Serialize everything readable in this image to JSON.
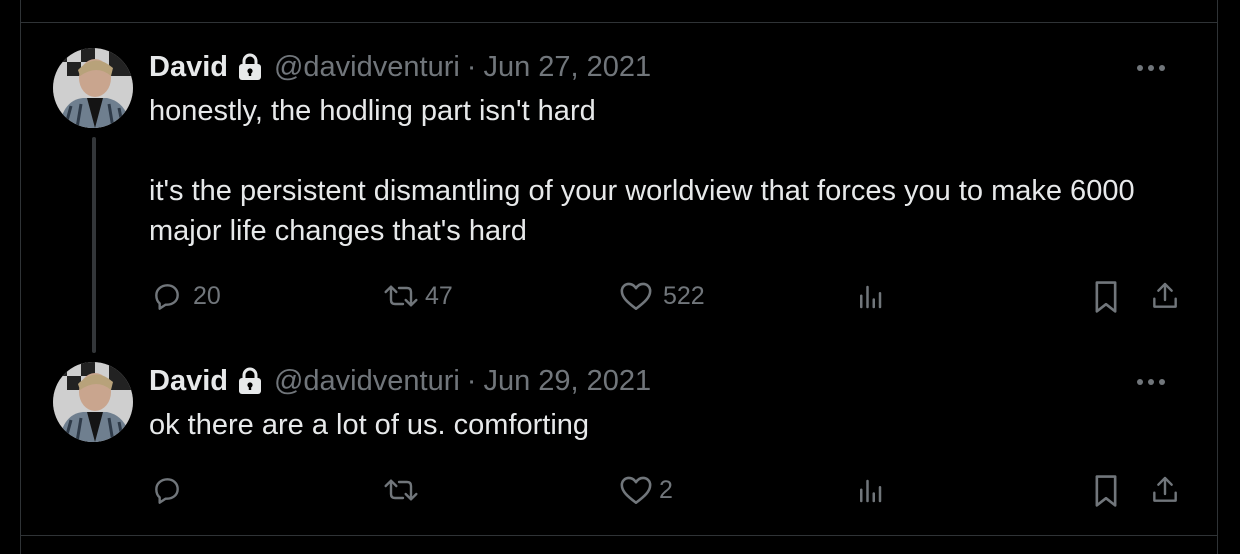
{
  "tweets": [
    {
      "author_name": "David",
      "handle": "@davidventuri",
      "separator": "·",
      "date": "Jun 27, 2021",
      "text": "honestly, the hodling part isn't hard\n\nit's the persistent dismantling of your worldview that forces you to make 6000 major life changes that's hard",
      "replies": "20",
      "retweets": "47",
      "likes": "522"
    },
    {
      "author_name": "David",
      "handle": "@davidventuri",
      "separator": "·",
      "date": "Jun 29, 2021",
      "text": "ok there are a lot of us. comforting",
      "replies": "",
      "retweets": "",
      "likes": "2"
    }
  ],
  "icons": {
    "protected": "lock-icon",
    "more": "more-horizontal-icon",
    "reply": "reply-icon",
    "retweet": "retweet-icon",
    "like": "heart-icon",
    "views": "views-icon",
    "bookmark": "bookmark-icon",
    "share": "share-icon"
  },
  "colors": {
    "background": "#000000",
    "text": "#e7e9ea",
    "secondary": "#71767b",
    "border": "#2f3336"
  }
}
